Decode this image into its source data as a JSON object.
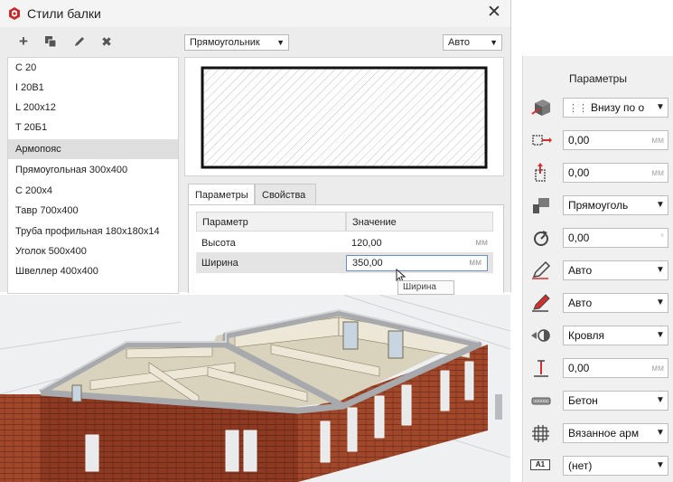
{
  "dialog": {
    "title": "Стили балки",
    "toolbar": {
      "add": "+",
      "copy": "⧉",
      "edit": "✎",
      "delete": "✖"
    },
    "styles": [
      "С 20",
      "I 20B1",
      "L 200x12",
      "T 20Б1",
      "Армопояс",
      "Прямоугольная 300x400",
      "С 200x4",
      "Тавр 700x400",
      "Труба профильная 180x180x14",
      "Уголок 500x400",
      "Швеллер 400x400"
    ],
    "selected_style_index": 4,
    "shape_select": "Прямоугольник",
    "auto_select": "Авто",
    "tabs": [
      "Параметры",
      "Свойства"
    ],
    "table": {
      "headers": [
        "Параметр",
        "Значение"
      ],
      "rows": [
        {
          "name": "Высота",
          "value": "120,00",
          "unit": "мм"
        },
        {
          "name": "Ширина",
          "value": "350,00",
          "unit": "мм"
        }
      ]
    },
    "tooltip": "Ширина"
  },
  "params_panel": {
    "title": "Параметры",
    "rows": [
      {
        "icon": "beam-placement-icon",
        "value": "Внизу по о",
        "type": "select",
        "prefix_icon": "grid-dots-icon"
      },
      {
        "icon": "offset-horizontal-icon",
        "value": "0,00",
        "unit": "мм",
        "type": "number"
      },
      {
        "icon": "offset-vertical-icon",
        "value": "0,00",
        "unit": "мм",
        "type": "number"
      },
      {
        "icon": "profile-icon",
        "value": "Прямоуголь",
        "type": "select"
      },
      {
        "icon": "rotation-icon",
        "value": "0,00",
        "unit": "°",
        "type": "number"
      },
      {
        "icon": "pen-icon",
        "value": "Авто",
        "type": "select"
      },
      {
        "icon": "pen-red-icon",
        "value": "Авто",
        "type": "select"
      },
      {
        "icon": "layer-icon",
        "value": "Кровля",
        "type": "select"
      },
      {
        "icon": "height-icon",
        "value": "0,00",
        "unit": "мм",
        "type": "number"
      },
      {
        "icon": "material-icon",
        "value": "Бетон",
        "type": "select"
      },
      {
        "icon": "reinforcement-icon",
        "value": "Вязанное арм",
        "type": "select"
      },
      {
        "icon": "label-icon",
        "value": "(нет)",
        "type": "select",
        "icon_text": "A1"
      }
    ]
  },
  "colors": {
    "brick": "#8e3a22",
    "beam": "#a7a9ad",
    "wall_inner": "#e9e4d2",
    "floor": "#d9d3bd"
  }
}
